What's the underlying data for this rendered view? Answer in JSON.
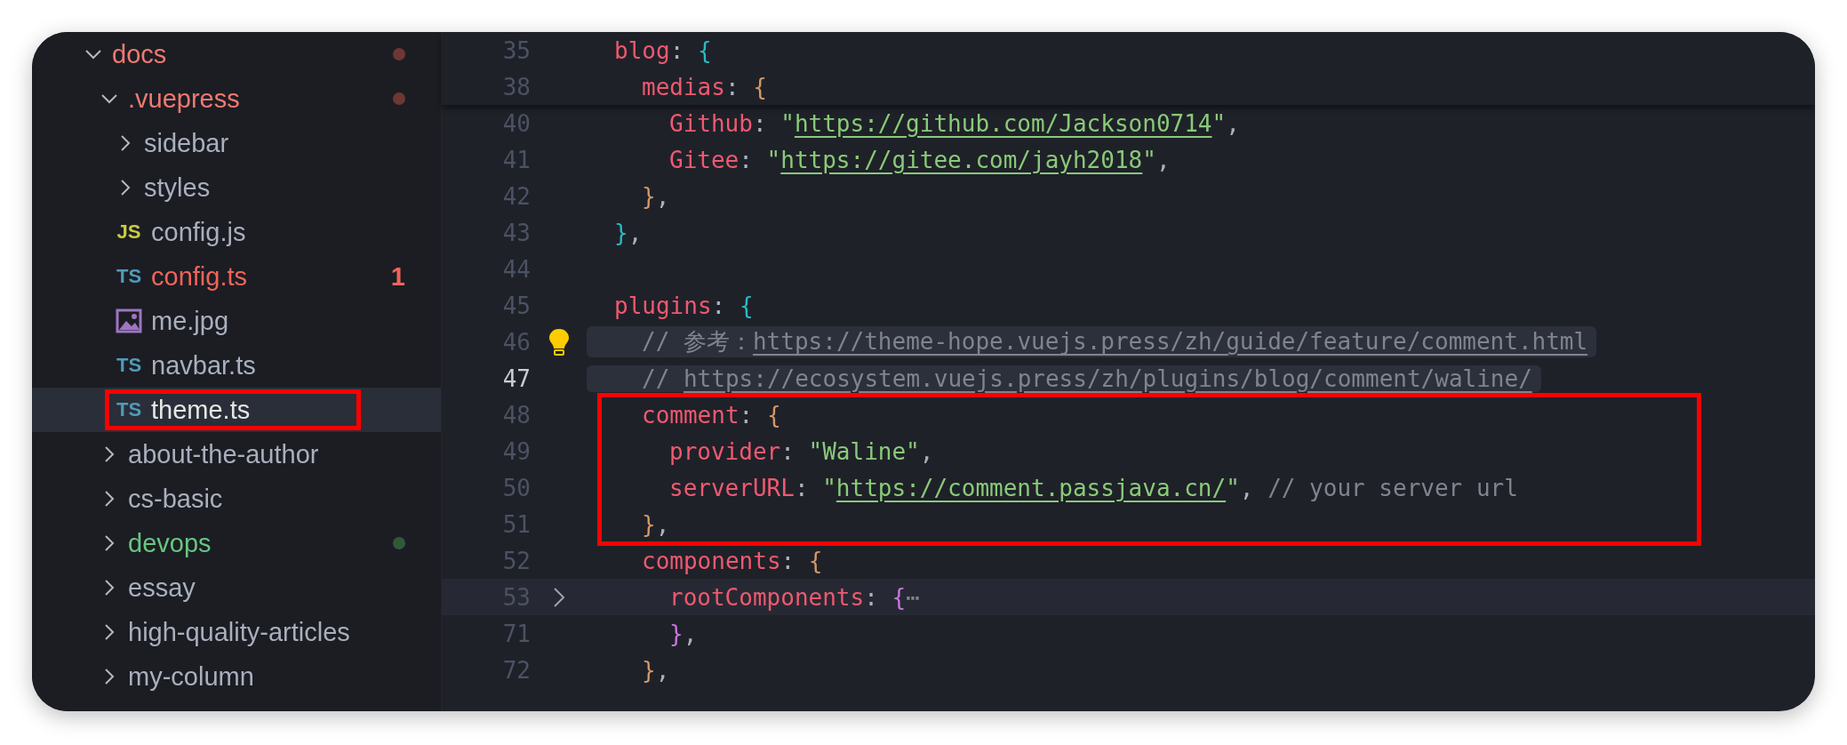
{
  "explorer": {
    "items": [
      {
        "kind": "folder",
        "label": "docs",
        "expanded": true,
        "color": "#6e3733",
        "dot": true,
        "children": [
          {
            "kind": "folder",
            "label": ".vuepress",
            "expanded": true,
            "color": "#6e3733",
            "dot": true,
            "children": [
              {
                "kind": "folder",
                "label": "sidebar",
                "expanded": false
              },
              {
                "kind": "folder",
                "label": "styles",
                "expanded": false
              },
              {
                "kind": "code",
                "icon_label": "JS",
                "label": "config.js",
                "selected": false,
                "highlighted": false
              },
              {
                "kind": "code",
                "icon_label": "TS",
                "label": "config.ts",
                "color": "#f0645a",
                "badge": "1",
                "selected": false,
                "highlighted": false
              },
              {
                "kind": "image",
                "label": "me.jpg",
                "selected": false,
                "highlighted": false
              },
              {
                "kind": "code",
                "icon_label": "TS",
                "label": "navbar.ts",
                "selected": false,
                "highlighted": false
              },
              {
                "kind": "code",
                "icon_label": "TS",
                "label": "theme.ts",
                "selected": true,
                "highlighted": true
              }
            ]
          },
          {
            "kind": "folder",
            "label": "about-the-author",
            "expanded": false
          },
          {
            "kind": "folder",
            "label": "cs-basic",
            "expanded": false
          },
          {
            "kind": "folder",
            "label": "devops",
            "expanded": false,
            "color": "#2f5a3a",
            "dot": true
          },
          {
            "kind": "folder",
            "label": "essay",
            "expanded": false
          },
          {
            "kind": "folder",
            "label": "high-quality-articles",
            "expanded": false
          },
          {
            "kind": "folder",
            "label": "my-column",
            "expanded": false
          }
        ]
      }
    ]
  },
  "editor": {
    "sticky_lines": [
      {
        "number": "35",
        "tokens": [
          {
            "kind": "key",
            "s": "blog"
          },
          {
            "kind": "punct",
            "s": ": "
          },
          {
            "kind": "brace",
            "s": "{",
            "color": "#2bbac5"
          }
        ]
      },
      {
        "number": "38",
        "tokens": [
          {
            "kind": "key",
            "s": "medias"
          },
          {
            "kind": "punct",
            "s": ": "
          },
          {
            "kind": "brace",
            "s": "{",
            "color": "#d19a66"
          }
        ]
      }
    ],
    "lines": [
      {
        "number": "40",
        "tokens": [
          {
            "kind": "key",
            "s": "Github"
          },
          {
            "kind": "punct",
            "s": ": "
          },
          {
            "kind": "str",
            "s": "\""
          },
          {
            "kind": "url",
            "s": "https://github.com/Jackson0714"
          },
          {
            "kind": "str",
            "s": "\""
          },
          {
            "kind": "punct",
            "s": ","
          }
        ]
      },
      {
        "number": "41",
        "tokens": [
          {
            "kind": "key",
            "s": "Gitee"
          },
          {
            "kind": "punct",
            "s": ": "
          },
          {
            "kind": "str",
            "s": "\""
          },
          {
            "kind": "url",
            "s": "https://gitee.com/jayh2018"
          },
          {
            "kind": "str",
            "s": "\""
          },
          {
            "kind": "punct",
            "s": ","
          }
        ]
      },
      {
        "number": "42",
        "tokens": [
          {
            "kind": "brace",
            "s": "}",
            "color": "#d19a66"
          },
          {
            "kind": "punct",
            "s": ","
          }
        ]
      },
      {
        "number": "43",
        "tokens": [
          {
            "kind": "brace",
            "s": "}",
            "color": "#2bbac5"
          },
          {
            "kind": "punct",
            "s": ","
          }
        ]
      },
      {
        "number": "44"
      },
      {
        "number": "45",
        "tokens": [
          {
            "kind": "key",
            "s": "plugins"
          },
          {
            "kind": "punct",
            "s": ": "
          },
          {
            "kind": "brace",
            "s": "{",
            "color": "#2bbac5"
          }
        ]
      },
      {
        "number": "46",
        "kind": "lightbulb",
        "selected": true,
        "active": false,
        "tokens": [
          {
            "kind": "comment",
            "s": "// 参考："
          },
          {
            "kind": "curl",
            "s": "https://theme-hope.vuejs.press/zh/guide/feature/comment.html"
          }
        ]
      },
      {
        "number": "47",
        "selected": true,
        "active": true,
        "tokens": [
          {
            "kind": "comment",
            "s": "// "
          },
          {
            "kind": "curl",
            "s": "https://ecosystem.vuejs.press/zh/plugins/blog/comment/waline/"
          }
        ]
      },
      {
        "number": "48",
        "highlighted": true,
        "tokens": [
          {
            "kind": "key",
            "s": "comment"
          },
          {
            "kind": "punct",
            "s": ": "
          },
          {
            "kind": "brace",
            "s": "{",
            "color": "#d19a66"
          }
        ]
      },
      {
        "number": "49",
        "highlighted": true,
        "tokens": [
          {
            "kind": "key",
            "s": "provider"
          },
          {
            "kind": "punct",
            "s": ": "
          },
          {
            "kind": "str",
            "s": "\"Waline\""
          },
          {
            "kind": "punct",
            "s": ","
          }
        ]
      },
      {
        "number": "50",
        "highlighted": true,
        "tokens": [
          {
            "kind": "key",
            "s": "serverURL"
          },
          {
            "kind": "punct",
            "s": ": "
          },
          {
            "kind": "str",
            "s": "\""
          },
          {
            "kind": "url",
            "s": "https://comment.passjava.cn/"
          },
          {
            "kind": "str",
            "s": "\""
          },
          {
            "kind": "punct",
            "s": ", "
          },
          {
            "kind": "comment",
            "s": "// your server url"
          }
        ]
      },
      {
        "number": "51",
        "highlighted": true,
        "tokens": [
          {
            "kind": "brace",
            "s": "}",
            "color": "#d19a66"
          },
          {
            "kind": "punct",
            "s": ","
          }
        ]
      },
      {
        "number": "52",
        "tokens": [
          {
            "kind": "key",
            "s": "components"
          },
          {
            "kind": "punct",
            "s": ": "
          },
          {
            "kind": "brace",
            "s": "{",
            "color": "#d19a66"
          }
        ]
      },
      {
        "number": "53",
        "kind": "fold",
        "hovered": true,
        "tokens": [
          {
            "kind": "key",
            "s": "rootComponents"
          },
          {
            "kind": "punct",
            "s": ": "
          },
          {
            "kind": "brace",
            "s": "{",
            "color": "#c678dd"
          },
          {
            "kind": "ellipsis",
            "s": "⋯"
          }
        ]
      },
      {
        "number": "71",
        "tokens": [
          {
            "kind": "brace",
            "s": "}",
            "color": "#c678dd"
          },
          {
            "kind": "punct",
            "s": ","
          }
        ]
      },
      {
        "number": "72",
        "tokens": [
          {
            "kind": "brace",
            "s": "}",
            "color": "#d19a66"
          },
          {
            "kind": "punct",
            "s": ","
          }
        ]
      }
    ]
  }
}
